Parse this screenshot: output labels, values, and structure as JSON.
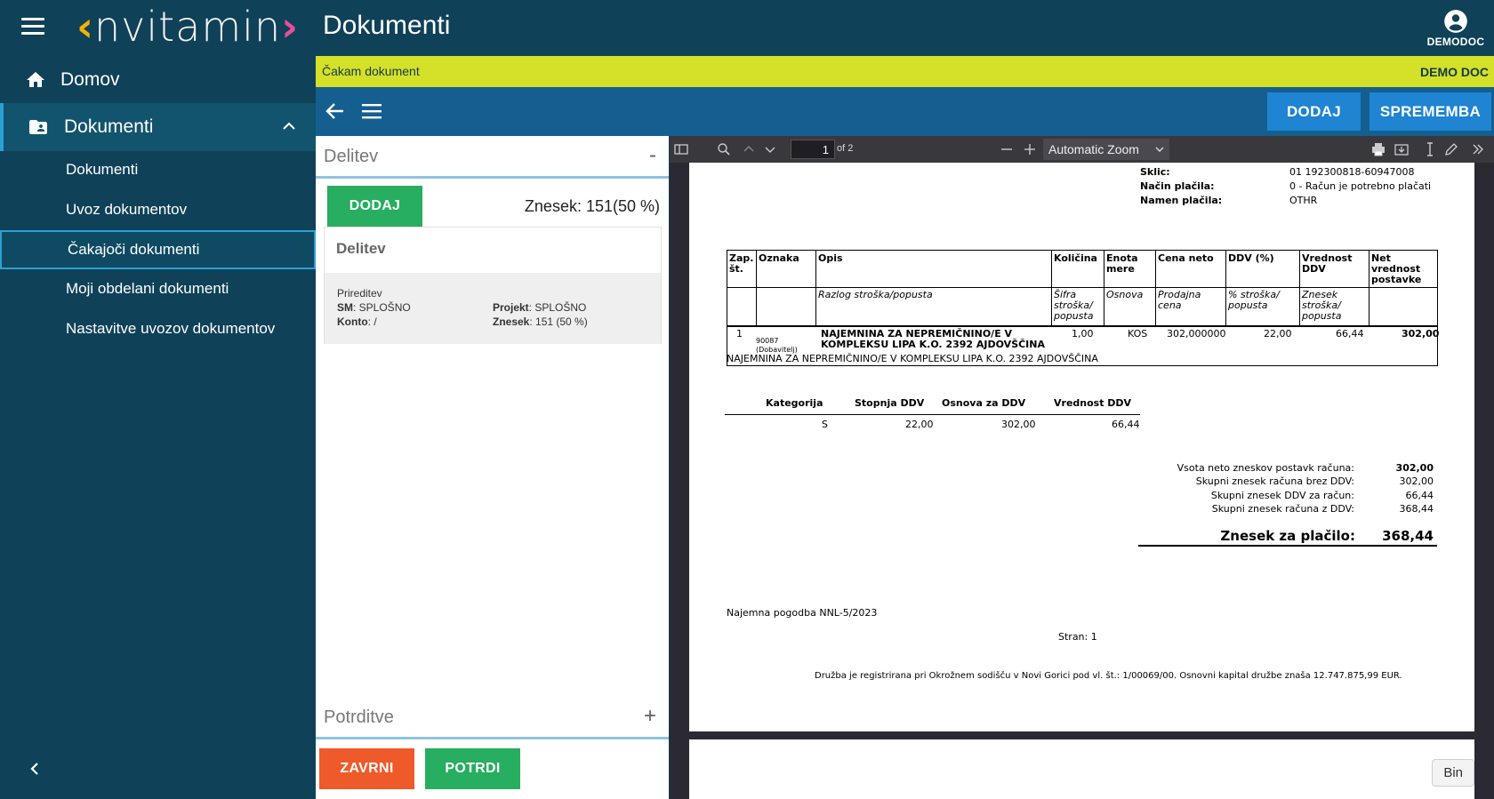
{
  "sidebar": {
    "logo": "nvitamin",
    "home_label": "Domov",
    "docs_label": "Dokumenti",
    "sub_items": [
      "Dokumenti",
      "Uvoz dokumentov",
      "Čakajoči dokumenti",
      "Moji obdelani dokumenti",
      "Nastavitve uvozov dokumentov"
    ]
  },
  "header": {
    "title": "Dokumenti",
    "user": "DEMODOC"
  },
  "status": {
    "text": "Čakam dokument",
    "company": "DEMO DOC"
  },
  "actions": {
    "add": "DODAJ",
    "change": "SPREMEMBA"
  },
  "delitev": {
    "title": "Delitev",
    "toggle": "-",
    "add": "DODAJ",
    "znesek": "Znesek: 151(50 %)",
    "card": {
      "title": "Delitev",
      "name": "Prireditev",
      "sm_label": "SM",
      "sm_value": ": SPLOŠNO",
      "projekt_label": "Projekt",
      "projekt_value": ": SPLOŠNO",
      "konto_label": "Konto",
      "konto_value": ": /",
      "znesek_label": "Znesek",
      "znesek_value": ": 151 (50 %)"
    }
  },
  "potrditve": {
    "title": "Potrditve",
    "toggle": "+"
  },
  "bottom": {
    "finish": "ZAVRNI",
    "confirm": "POTRDI"
  },
  "pdf": {
    "page": "1",
    "page_of": "of 2",
    "zoom": "Automatic Zoom",
    "header_fields": [
      {
        "label": "Sklic:",
        "value": "01 192300818-60947008"
      },
      {
        "label": "Način plačila:",
        "value": "0 - Račun je potrebno plačati"
      },
      {
        "label": "Namen plačila:",
        "value": "OTHR"
      }
    ],
    "table_headers": [
      "Zap.",
      "št.",
      "Oznaka",
      "Opis",
      "Količina",
      "Enota",
      "mere",
      "Cena neto",
      "DDV (%)",
      "Vrednost",
      "DDV",
      "Net",
      "vrednost",
      "postavke"
    ],
    "table_sub": [
      "Razlog stroška/popusta",
      "Šifra",
      "stroška/",
      "popusta",
      "Osnova",
      "Prodajna",
      "cena",
      "% stroška/",
      "popusta",
      "Znesek",
      "stroška/",
      "popusta"
    ],
    "row": {
      "nr": "1",
      "code": "90087",
      "code_sub": "(Dobavitelj)",
      "desc1": "NAJEMNINA ZA NEPREMIČNINO/E V",
      "desc2": "KOMPLEKSU LIPA K.O. 2392 AJDOVŠČINA",
      "qty": "1,00",
      "unit": "KOS",
      "price": "302,000000",
      "vat": "22,00",
      "vat_value": "66,44",
      "net": "302,00",
      "note": "NAJEMNINA ZA NEPREMIČNINO/E V KOMPLEKSU LIPA K.O. 2392 AJDOVŠČINA"
    },
    "vat_headers": [
      "Kategorija",
      "Stopnja DDV",
      "Osnova za DDV",
      "Vrednost DDV"
    ],
    "vat_row": [
      "S",
      "22,00",
      "302,00",
      "66,44"
    ],
    "totals": [
      {
        "label": "Vsota neto zneskov postavk računa:",
        "value": "302,00"
      },
      {
        "label": "Skupni znesek računa brez DDV:",
        "value": "302,00"
      },
      {
        "label": "Skupni znesek DDV za račun:",
        "value": "66,44"
      },
      {
        "label": "Skupni znesek računa z DDV:",
        "value": "368,44"
      }
    ],
    "pay_label": "Znesek za plačilo:",
    "pay_value": "368,44",
    "contract": "Najemna pogodba NNL-5/2023",
    "page_label": "Stran: 1",
    "footer": "Družba je registrirana pri Okrožnem sodišču v Novi Gorici pod vl. št.: 1/00069/00. Osnovni kapital družbe znaša 12.747.875,99 EUR."
  },
  "bin_label": "Bin",
  "colors": {
    "sidebar": "#0f4158",
    "accent": "#2ba0d6",
    "status": "#d5e028",
    "actionbar": "#155e90",
    "button_blue": "#1f84d1",
    "green": "#27ae60",
    "orange": "#ee5a2a"
  }
}
